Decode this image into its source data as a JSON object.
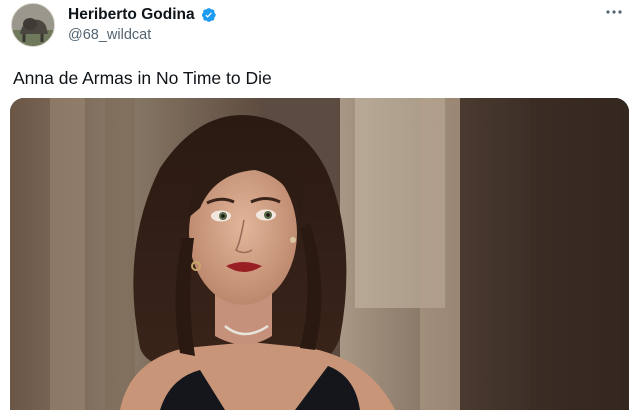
{
  "author": {
    "display_name": "Heriberto Godina",
    "handle": "@68_wildcat",
    "verified": true,
    "verified_color": "#1d9bf0"
  },
  "tweet": {
    "text": "Anna de Armas in No Time to Die"
  },
  "icons": {
    "verified": "verified-badge-icon",
    "more": "more-options-icon",
    "avatar": "user-avatar"
  }
}
